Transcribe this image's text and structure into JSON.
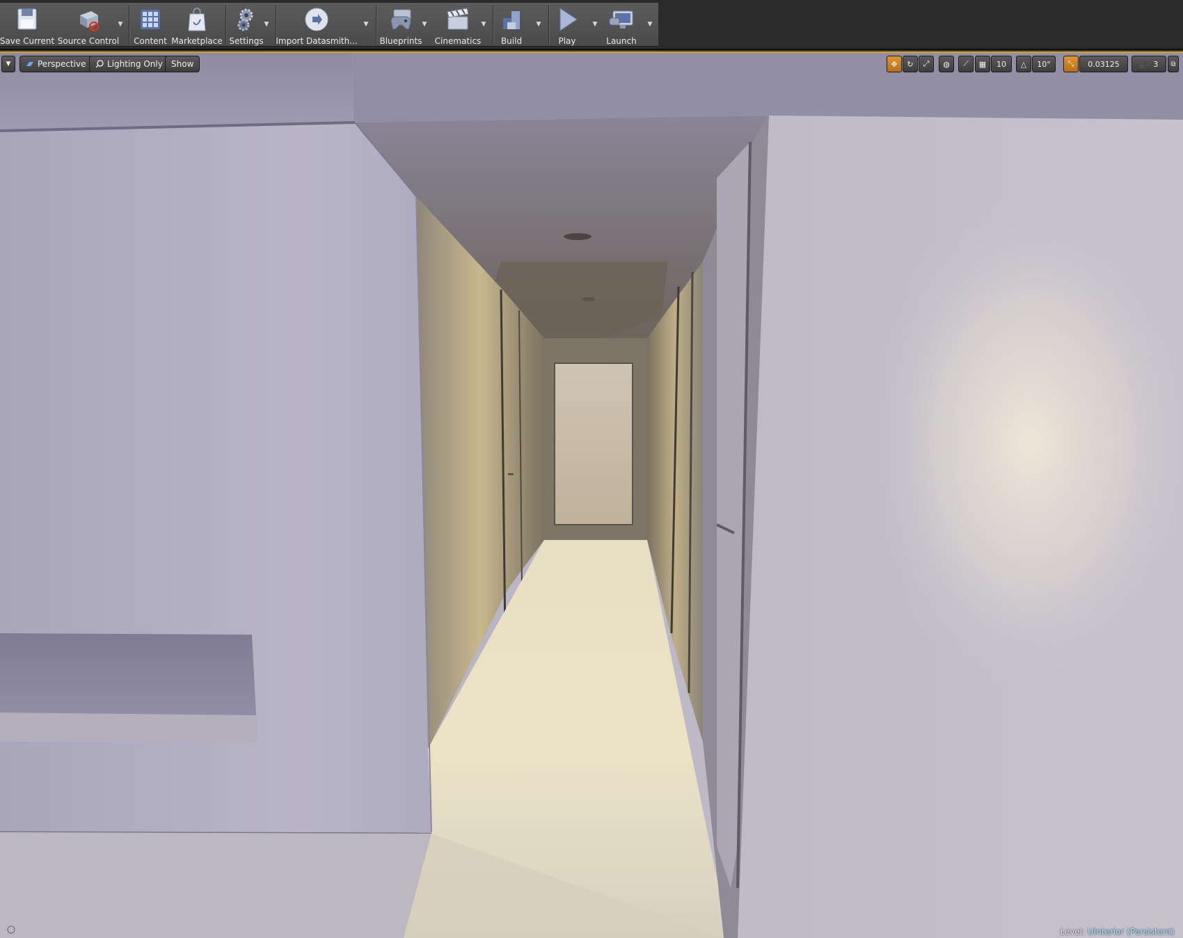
{
  "toolbar": {
    "buttons": [
      {
        "label": "Save Current",
        "icon": "save-icon"
      },
      {
        "label": "Source Control",
        "icon": "source-control-icon"
      },
      {
        "label": "Content",
        "icon": "content-icon"
      },
      {
        "label": "Marketplace",
        "icon": "marketplace-icon"
      },
      {
        "label": "Settings",
        "icon": "settings-icon"
      },
      {
        "label": "Import Datasmith...",
        "icon": "datasmith-icon"
      },
      {
        "label": "Blueprints",
        "icon": "blueprints-icon"
      },
      {
        "label": "Cinematics",
        "icon": "cinematics-icon"
      },
      {
        "label": "Build",
        "icon": "build-icon"
      },
      {
        "label": "Play",
        "icon": "play-icon"
      },
      {
        "label": "Launch",
        "icon": "launch-icon"
      }
    ]
  },
  "viewport": {
    "view_mode_label": "Perspective",
    "lighting_label": "Lighting Only",
    "show_label": "Show",
    "grid_snap_value": "10",
    "rotation_snap_value": "10°",
    "scale_snap_value": "0.03125",
    "camera_speed_value": "3",
    "level_prefix": "Level:",
    "level_name": "UInterior (Persistent)"
  },
  "colors": {
    "accent": "#d6a21e",
    "active_tool": "#d08420",
    "level_name": "#9fe6ff"
  }
}
